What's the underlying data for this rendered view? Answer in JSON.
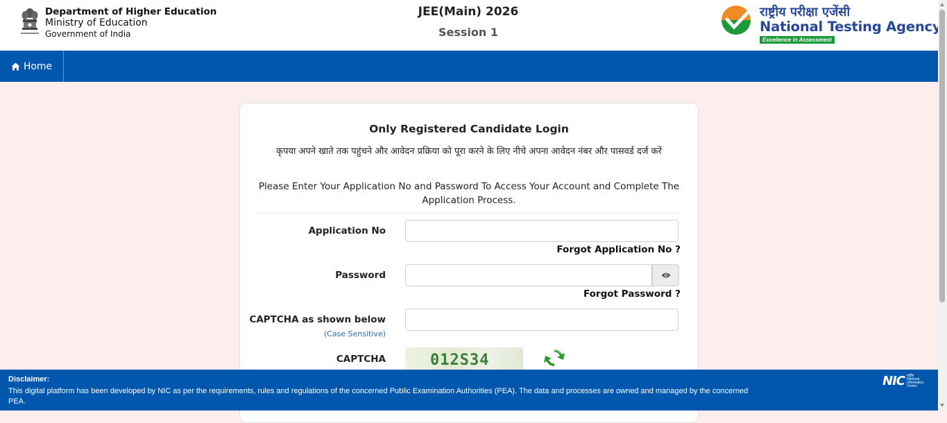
{
  "header": {
    "dept_line1": "Department of Higher Education",
    "dept_line2": "Ministry of Education",
    "dept_line3": "Government of India",
    "exam_title": "JEE(Main) 2026",
    "exam_session": "Session 1",
    "nta_hindi": "राष्ट्रीय परीक्षा एजेंसी",
    "nta_name": "National Testing Agency",
    "nta_tagline": "Excellence in Assessment"
  },
  "nav": {
    "home_label": "Home"
  },
  "login": {
    "title": "Only Registered Candidate Login",
    "hindi_instruction": "कृपया अपने खाते तक पहुंचने और आवेदन प्रक्रिया को पूरा करने के लिए नीचे अपना आवेदन नंबर और पासवर्ड दर्ज करें",
    "english_instruction": "Please Enter Your Application No and Password To Access Your Account and Complete The Application Process.",
    "application_no_label": "Application No",
    "application_no_value": "",
    "forgot_application_no": "Forgot Application No ?",
    "password_label": "Password",
    "password_value": "",
    "forgot_password": "Forgot Password ?",
    "captcha_input_label": "CAPTCHA as shown below",
    "captcha_case_note": "(Case Sensitive)",
    "captcha_input_value": "",
    "captcha_label": "CAPTCHA",
    "captcha_text": "012S34"
  },
  "footer": {
    "disclaimer_title": "Disclaimer:",
    "disclaimer_text": "This digital platform has been developed by NIC as per the requirements, rules and regulations of the concerned Public Examination Authorities (PEA). The data and processes are owned and managed by the concerned PEA.",
    "nic_logo_text": "NIC",
    "nic_small_text": "राष्ट्रीय National Informatics Centre"
  },
  "colors": {
    "nav_blue": "#0057ad",
    "page_bg": "#fdeeee",
    "nta_blue": "#27479a",
    "nta_green": "#1b9a3c"
  }
}
